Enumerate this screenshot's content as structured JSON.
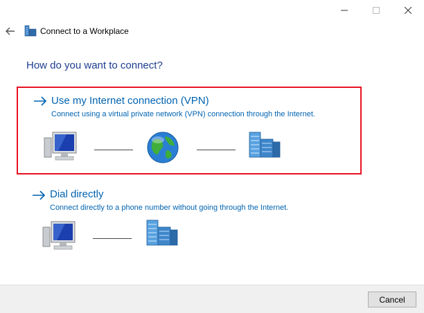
{
  "window": {
    "minimize_icon": "minimize-icon",
    "maximize_icon": "maximize-icon",
    "close_icon": "close-icon"
  },
  "header": {
    "title": "Connect to a Workplace"
  },
  "question": "How do you want to connect?",
  "options": [
    {
      "title": "Use my Internet connection (VPN)",
      "description": "Connect using a virtual private network (VPN) connection through the Internet.",
      "selected": true,
      "diagram": [
        "computer-icon",
        "internet-globe-icon",
        "workplace-building-icon"
      ]
    },
    {
      "title": "Dial directly",
      "description": "Connect directly to a phone number without going through the Internet.",
      "selected": false,
      "diagram": [
        "computer-icon",
        "workplace-building-icon"
      ]
    }
  ],
  "footer": {
    "cancel_label": "Cancel"
  },
  "colors": {
    "heading": "#1c3d8e",
    "link": "#0063b1",
    "highlight_border": "#e81123",
    "footer_bg": "#f0f0f0"
  }
}
